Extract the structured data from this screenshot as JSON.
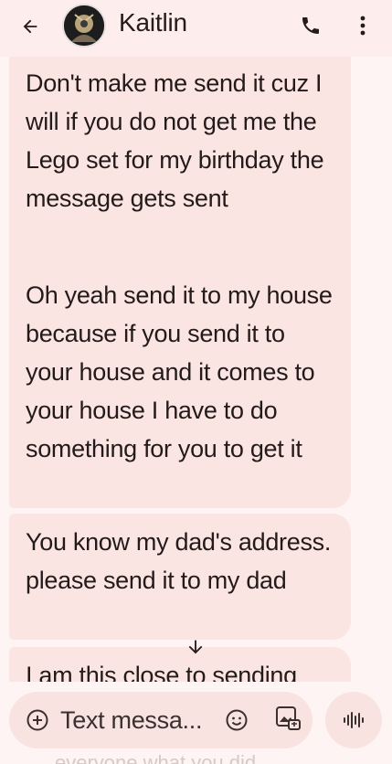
{
  "header": {
    "contact_name": "Kaitlin",
    "back_icon": "arrow-left-icon",
    "call_icon": "phone-icon",
    "more_icon": "more-vert-icon"
  },
  "messages": [
    {
      "text": "Don't make me send it cuz I will if you do not get me the Lego set for my birthday the message gets sent"
    },
    {
      "text": "Oh yeah send it to my house because if you send it to your house and it comes to your house I have to do something for you to get it"
    },
    {
      "text": "You know my dad's address. please send it to my dad"
    },
    {
      "text": "I am this close to sending"
    }
  ],
  "composer": {
    "placeholder": "Text messa...",
    "add_icon": "add-circle-icon",
    "emoji_icon": "emoji-icon",
    "attach_icon": "gallery-attach-icon",
    "voice_icon": "voice-waveform-icon"
  },
  "bottom_partial_text": "everyone what you did",
  "colors": {
    "background": "#fdf4f3",
    "bubble": "#fbe5e3",
    "header": "#fdeeed",
    "text": "#231a1a"
  }
}
